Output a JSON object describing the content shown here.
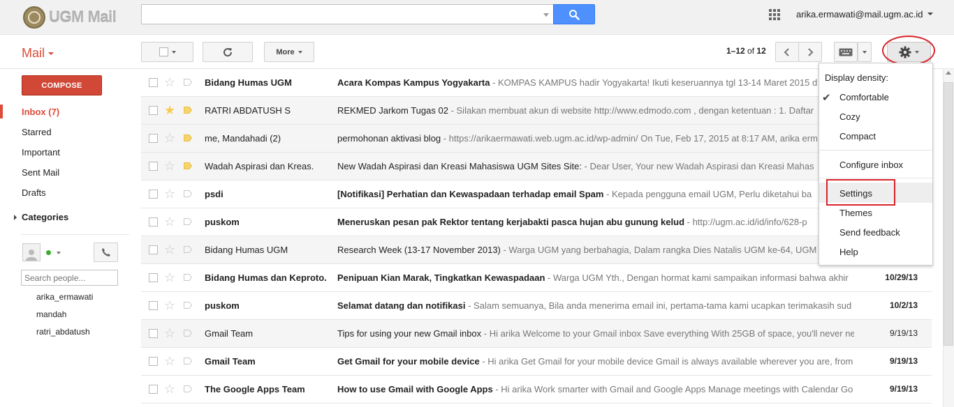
{
  "header": {
    "logo_text": "UGM Mail",
    "search_value": "",
    "user_email": "arika.ermawati@mail.ugm.ac.id"
  },
  "toolbar": {
    "mail_label": "Mail",
    "more_label": "More",
    "pager_range": "1–12",
    "pager_of": "of",
    "pager_total": "12"
  },
  "nav": {
    "compose_label": "COMPOSE",
    "items": [
      {
        "label": "Inbox (7)"
      },
      {
        "label": "Starred"
      },
      {
        "label": "Important"
      },
      {
        "label": "Sent Mail"
      },
      {
        "label": "Drafts"
      }
    ],
    "categories_label": "Categories"
  },
  "chat": {
    "search_placeholder": "Search people...",
    "contacts": [
      "arika_ermawati",
      "mandah",
      "ratri_abdatush"
    ]
  },
  "emails": [
    {
      "sender": "Bidang Humas UGM",
      "subject": "Acara Kompas Kampus Yogyakarta",
      "snippet": " - KOMPAS KAMPUS hadir Yogyakarta! Ikuti keseruannya tgl 13-14 Maret 2015 d",
      "date": "",
      "unread": true,
      "starred": false,
      "important": false
    },
    {
      "sender": "RATRI ABDATUSH S",
      "subject": "REKMED Jarkom Tugas 02",
      "snippet": " - Silakan membuat akun di website http://www.edmodo.com , dengan ketentuan : 1. Daftar",
      "date": "",
      "unread": false,
      "starred": true,
      "important": true
    },
    {
      "sender": "me, Mandahadi (2)",
      "subject": "permohonan aktivasi blog",
      "snippet": " - https://arikaermawati.web.ugm.ac.id/wp-admin/ On Tue, Feb 17, 2015 at 8:17 AM, arika erm",
      "date": "",
      "unread": false,
      "starred": false,
      "important": true
    },
    {
      "sender": "Wadah Aspirasi dan Kreas.",
      "subject": "New Wadah Aspirasi dan Kreasi Mahasiswa UGM Sites Site:",
      "snippet": " - Dear User, Your new Wadah Aspirasi dan Kreasi Mahas",
      "date": "",
      "unread": false,
      "starred": false,
      "important": true
    },
    {
      "sender": "psdi",
      "subject": "[Notifikasi] Perhatian dan Kewaspadaan terhadap email Spam",
      "snippet": " - Kepada pengguna email UGM, Perlu diketahui ba",
      "date": "",
      "unread": true,
      "starred": false,
      "important": false
    },
    {
      "sender": "puskom",
      "subject": "Meneruskan pesan pak Rektor tentang kerjabakti pasca hujan abu gunung kelud",
      "snippet": " - http://ugm.ac.id/id/info/628-p",
      "date": "",
      "unread": true,
      "starred": false,
      "important": false
    },
    {
      "sender": "Bidang Humas UGM",
      "subject": "Research Week (13-17 November 2013)",
      "snippet": " - Warga UGM yang berbahagia, Dalam rangka Dies Natalis UGM ke-64, UGM",
      "date": "",
      "unread": false,
      "starred": false,
      "important": false
    },
    {
      "sender": "Bidang Humas dan Keproto.",
      "subject": "Penipuan Kian Marak, Tingkatkan Kewaspadaan",
      "snippet": " - Warga UGM Yth., Dengan hormat kami sampaikan informasi bahwa akhir",
      "date": "10/29/13",
      "unread": true,
      "starred": false,
      "important": false
    },
    {
      "sender": "puskom",
      "subject": "Selamat datang dan notifikasi",
      "snippet": " - Salam semuanya, Bila anda menerima email ini, pertama-tama kami ucapkan terimakasih sud",
      "date": "10/2/13",
      "unread": true,
      "starred": false,
      "important": false
    },
    {
      "sender": "Gmail Team",
      "subject": "Tips for using your new Gmail inbox",
      "snippet": " - Hi arika Welcome to your Gmail inbox Save everything With 25GB of space, you'll never ne",
      "date": "9/19/13",
      "unread": false,
      "starred": false,
      "important": false
    },
    {
      "sender": "Gmail Team",
      "subject": "Get Gmail for your mobile device",
      "snippet": " - Hi arika Get Gmail for your mobile device Gmail is always available wherever you are, from",
      "date": "9/19/13",
      "unread": true,
      "starred": false,
      "important": false
    },
    {
      "sender": "The Google Apps Team",
      "subject": "How to use Gmail with Google Apps",
      "snippet": " - Hi arika Work smarter with Gmail and Google Apps Manage meetings with Calendar Go",
      "date": "9/19/13",
      "unread": true,
      "starred": false,
      "important": false
    }
  ],
  "settings_menu": {
    "density_heading": "Display density:",
    "density_options": [
      "Comfortable",
      "Cozy",
      "Compact"
    ],
    "configure_inbox": "Configure inbox",
    "settings": "Settings",
    "themes": "Themes",
    "send_feedback": "Send feedback",
    "help": "Help"
  },
  "colors": {
    "accent_red": "#dd4b39",
    "search_blue": "#4d90fe",
    "star_yellow": "#f7cb4d",
    "important_yellow": "#f6d46c",
    "annotation_red": "#d8232a"
  },
  "icons": {
    "search_button": "magnifier-icon",
    "refresh": "refresh-icon",
    "settings": "gear-icon",
    "keyboard": "keyboard-icon",
    "apps": "apps-grid-icon",
    "chat_phone": "phone-icon"
  }
}
